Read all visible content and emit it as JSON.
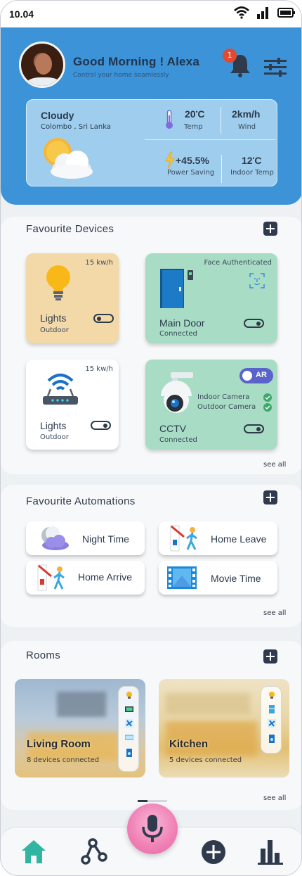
{
  "status_bar": {
    "time": "10.04"
  },
  "header": {
    "greeting": "Good Morning ! Alexa",
    "subtitle": "Control your home seamlessly",
    "notification_count": "1"
  },
  "weather": {
    "condition": "Cloudy",
    "location": "Colombo , Sri Lanka",
    "temp_value": "20",
    "temp_unit": "C",
    "temp_label": "Temp",
    "wind_value": "2km/h",
    "wind_label": "Wind",
    "power_value": "+45.5%",
    "power_label": "Power Saving",
    "indoor_value": "12",
    "indoor_unit": "C",
    "indoor_label": "Indoor Temp"
  },
  "favourite_devices": {
    "title": "Favourite Devices",
    "see_all": "see all",
    "devices": [
      {
        "name": "Lights",
        "sub": "Outdoor",
        "badge": "15 kw/h",
        "toggle": "off"
      },
      {
        "name": "Main Door",
        "sub": "Connected",
        "badge": "Face Authenticated",
        "toggle": "on"
      },
      {
        "name": "Lights",
        "sub": "Outdoor",
        "badge": "15 kw/h",
        "toggle": "on"
      },
      {
        "name": "CCTV",
        "sub": "Connected",
        "ar_label": "AR",
        "cameras": [
          "Indoor Camera",
          "Outdoor Camera"
        ],
        "toggle": "on"
      }
    ]
  },
  "favourite_automations": {
    "title": "Favourite Automations",
    "see_all": "see all",
    "items": [
      {
        "label": "Night Time",
        "icon": "moon-cloud-icon"
      },
      {
        "label": "Home Leave",
        "icon": "person-leaving-icon"
      },
      {
        "label": "Home Arrive",
        "icon": "person-arriving-icon"
      },
      {
        "label": "Movie Time",
        "icon": "film-icon"
      }
    ]
  },
  "rooms": {
    "title": "Rooms",
    "see_all": "see all",
    "items": [
      {
        "name": "Living Room",
        "sub": "8 devices connected"
      },
      {
        "name": "Kitchen",
        "sub": "5 devices connected"
      }
    ]
  },
  "nav": {
    "items": [
      "home-icon",
      "automation-graph-icon",
      "voice-mic-icon",
      "add-icon",
      "stats-icon"
    ],
    "active": "home-icon"
  },
  "colors": {
    "header_blue": "#3d93d8",
    "weather_card": "#9fcdee",
    "lights_card": "#f3d9a8",
    "green_card": "#a9dcc4",
    "nav_active": "#2fb5a0",
    "dark": "#2f3b4d",
    "mic_pink": "#f07fb4"
  }
}
